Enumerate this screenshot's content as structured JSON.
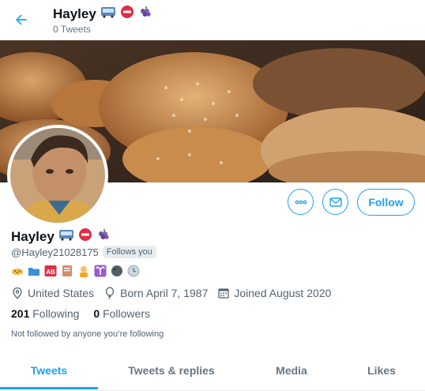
{
  "header": {
    "name": "Hayley",
    "tweet_count": "0 Tweets"
  },
  "profile": {
    "name": "Hayley",
    "handle": "@Hayley21028175",
    "follows_you_badge": "Follows you",
    "location": "United States",
    "birth": "Born April 7, 1987",
    "joined": "Joined August 2020",
    "following_count": "201",
    "following_label": "Following",
    "followers_count": "0",
    "followers_label": "Followers",
    "not_followed_text": "Not followed by anyone you’re following",
    "bio_emojis": [
      "leopard",
      "folder",
      "ab-blood-type",
      "notebook",
      "person-with-blond-hair",
      "aries",
      "dark-circle",
      "clock-face"
    ],
    "name_emojis": [
      "bus",
      "no-entry",
      "grapes"
    ]
  },
  "actions": {
    "follow_label": "Follow"
  },
  "tabs": [
    {
      "label": "Tweets",
      "active": true
    },
    {
      "label": "Tweets & replies",
      "active": false
    },
    {
      "label": "Media",
      "active": false
    },
    {
      "label": "Likes",
      "active": false
    }
  ],
  "colors": {
    "accent": "#1da1f2",
    "secondary_text": "#536471"
  }
}
